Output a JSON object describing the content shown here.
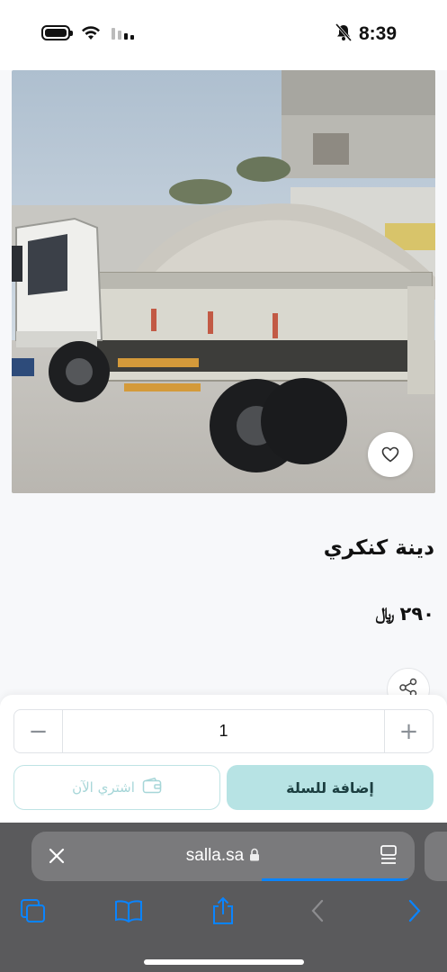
{
  "status_bar": {
    "time": "8:39",
    "icons": [
      "battery-icon",
      "wifi-icon",
      "signal-icon",
      "bell-slash-icon"
    ]
  },
  "product": {
    "image_alt": "dump-truck-with-gravel-photo",
    "title": "دينة كنكري",
    "price": "٢٩٠",
    "currency": "﷼"
  },
  "cart": {
    "quantity": "1",
    "minus_label": "−",
    "plus_label": "+",
    "buy_now_label": "اشتري الآن",
    "add_to_cart_label": "إضافة للسلة"
  },
  "browser": {
    "url": "salla.sa",
    "load_progress": 0.4
  },
  "colors": {
    "accent": "#b7e3e4",
    "accent_text": "#1c3f41",
    "outline": "#bfe3e4",
    "safari_blue": "#0a84ff"
  }
}
